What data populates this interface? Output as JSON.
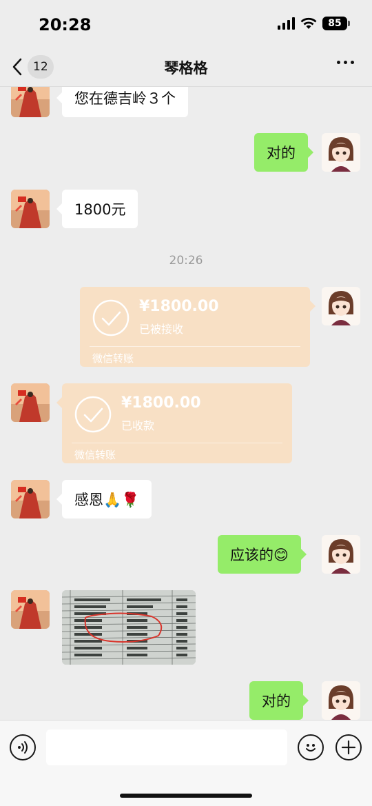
{
  "status_bar": {
    "time": "20:28",
    "battery": "85"
  },
  "nav": {
    "back_count": "12",
    "title": "琴格格"
  },
  "messages": {
    "m1": "您在德吉岭３个",
    "m2": "对的",
    "m3": "1800元",
    "time1": "20:26",
    "transfer_sent": {
      "amount": "¥1800.00",
      "status": "已被接收",
      "label": "微信转账"
    },
    "transfer_recv": {
      "amount": "¥1800.00",
      "status": "已收款",
      "label": "微信转账"
    },
    "m4": "感恩🙏🌹",
    "m5": "应该的😊",
    "m6": "对的"
  },
  "colors": {
    "sent_bubble": "#95ec69",
    "received_bubble": "#ffffff",
    "transfer_bubble": "#f8e0c5",
    "background": "#ededed"
  },
  "input_bar": {
    "placeholder": ""
  }
}
